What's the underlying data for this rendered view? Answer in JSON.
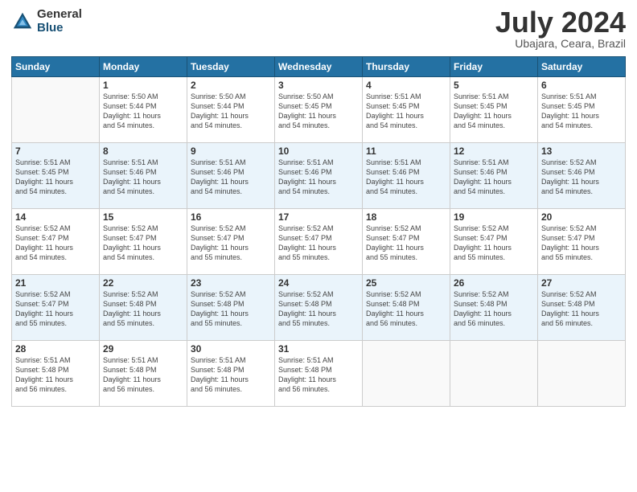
{
  "header": {
    "logo_general": "General",
    "logo_blue": "Blue",
    "month_title": "July 2024",
    "location": "Ubajara, Ceara, Brazil"
  },
  "columns": [
    "Sunday",
    "Monday",
    "Tuesday",
    "Wednesday",
    "Thursday",
    "Friday",
    "Saturday"
  ],
  "weeks": [
    [
      {
        "day": "",
        "info": ""
      },
      {
        "day": "1",
        "info": "Sunrise: 5:50 AM\nSunset: 5:44 PM\nDaylight: 11 hours\nand 54 minutes."
      },
      {
        "day": "2",
        "info": "Sunrise: 5:50 AM\nSunset: 5:44 PM\nDaylight: 11 hours\nand 54 minutes."
      },
      {
        "day": "3",
        "info": "Sunrise: 5:50 AM\nSunset: 5:45 PM\nDaylight: 11 hours\nand 54 minutes."
      },
      {
        "day": "4",
        "info": "Sunrise: 5:51 AM\nSunset: 5:45 PM\nDaylight: 11 hours\nand 54 minutes."
      },
      {
        "day": "5",
        "info": "Sunrise: 5:51 AM\nSunset: 5:45 PM\nDaylight: 11 hours\nand 54 minutes."
      },
      {
        "day": "6",
        "info": "Sunrise: 5:51 AM\nSunset: 5:45 PM\nDaylight: 11 hours\nand 54 minutes."
      }
    ],
    [
      {
        "day": "7",
        "info": "Sunrise: 5:51 AM\nSunset: 5:45 PM\nDaylight: 11 hours\nand 54 minutes."
      },
      {
        "day": "8",
        "info": "Sunrise: 5:51 AM\nSunset: 5:46 PM\nDaylight: 11 hours\nand 54 minutes."
      },
      {
        "day": "9",
        "info": "Sunrise: 5:51 AM\nSunset: 5:46 PM\nDaylight: 11 hours\nand 54 minutes."
      },
      {
        "day": "10",
        "info": "Sunrise: 5:51 AM\nSunset: 5:46 PM\nDaylight: 11 hours\nand 54 minutes."
      },
      {
        "day": "11",
        "info": "Sunrise: 5:51 AM\nSunset: 5:46 PM\nDaylight: 11 hours\nand 54 minutes."
      },
      {
        "day": "12",
        "info": "Sunrise: 5:51 AM\nSunset: 5:46 PM\nDaylight: 11 hours\nand 54 minutes."
      },
      {
        "day": "13",
        "info": "Sunrise: 5:52 AM\nSunset: 5:46 PM\nDaylight: 11 hours\nand 54 minutes."
      }
    ],
    [
      {
        "day": "14",
        "info": "Sunrise: 5:52 AM\nSunset: 5:47 PM\nDaylight: 11 hours\nand 54 minutes."
      },
      {
        "day": "15",
        "info": "Sunrise: 5:52 AM\nSunset: 5:47 PM\nDaylight: 11 hours\nand 54 minutes."
      },
      {
        "day": "16",
        "info": "Sunrise: 5:52 AM\nSunset: 5:47 PM\nDaylight: 11 hours\nand 55 minutes."
      },
      {
        "day": "17",
        "info": "Sunrise: 5:52 AM\nSunset: 5:47 PM\nDaylight: 11 hours\nand 55 minutes."
      },
      {
        "day": "18",
        "info": "Sunrise: 5:52 AM\nSunset: 5:47 PM\nDaylight: 11 hours\nand 55 minutes."
      },
      {
        "day": "19",
        "info": "Sunrise: 5:52 AM\nSunset: 5:47 PM\nDaylight: 11 hours\nand 55 minutes."
      },
      {
        "day": "20",
        "info": "Sunrise: 5:52 AM\nSunset: 5:47 PM\nDaylight: 11 hours\nand 55 minutes."
      }
    ],
    [
      {
        "day": "21",
        "info": "Sunrise: 5:52 AM\nSunset: 5:47 PM\nDaylight: 11 hours\nand 55 minutes."
      },
      {
        "day": "22",
        "info": "Sunrise: 5:52 AM\nSunset: 5:48 PM\nDaylight: 11 hours\nand 55 minutes."
      },
      {
        "day": "23",
        "info": "Sunrise: 5:52 AM\nSunset: 5:48 PM\nDaylight: 11 hours\nand 55 minutes."
      },
      {
        "day": "24",
        "info": "Sunrise: 5:52 AM\nSunset: 5:48 PM\nDaylight: 11 hours\nand 55 minutes."
      },
      {
        "day": "25",
        "info": "Sunrise: 5:52 AM\nSunset: 5:48 PM\nDaylight: 11 hours\nand 56 minutes."
      },
      {
        "day": "26",
        "info": "Sunrise: 5:52 AM\nSunset: 5:48 PM\nDaylight: 11 hours\nand 56 minutes."
      },
      {
        "day": "27",
        "info": "Sunrise: 5:52 AM\nSunset: 5:48 PM\nDaylight: 11 hours\nand 56 minutes."
      }
    ],
    [
      {
        "day": "28",
        "info": "Sunrise: 5:51 AM\nSunset: 5:48 PM\nDaylight: 11 hours\nand 56 minutes."
      },
      {
        "day": "29",
        "info": "Sunrise: 5:51 AM\nSunset: 5:48 PM\nDaylight: 11 hours\nand 56 minutes."
      },
      {
        "day": "30",
        "info": "Sunrise: 5:51 AM\nSunset: 5:48 PM\nDaylight: 11 hours\nand 56 minutes."
      },
      {
        "day": "31",
        "info": "Sunrise: 5:51 AM\nSunset: 5:48 PM\nDaylight: 11 hours\nand 56 minutes."
      },
      {
        "day": "",
        "info": ""
      },
      {
        "day": "",
        "info": ""
      },
      {
        "day": "",
        "info": ""
      }
    ]
  ]
}
